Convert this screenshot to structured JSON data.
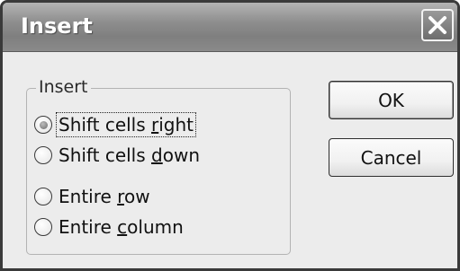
{
  "dialog": {
    "title": "Insert",
    "close_icon": "close-x-icon"
  },
  "group": {
    "label": "Insert",
    "options": [
      {
        "pre": "Shift cells ",
        "key": "r",
        "post": "ight",
        "selected": true
      },
      {
        "pre": "Shift cells ",
        "key": "d",
        "post": "own",
        "selected": false
      },
      {
        "pre": "Entire ",
        "key": "r",
        "post": "ow",
        "selected": false
      },
      {
        "pre": "Entire ",
        "key": "c",
        "post": "olumn",
        "selected": false
      }
    ]
  },
  "buttons": {
    "ok_label": "OK",
    "cancel_label": "Cancel"
  },
  "colors": {
    "titlebar": "#8e8e8e",
    "dialog_bg": "#ececec"
  }
}
